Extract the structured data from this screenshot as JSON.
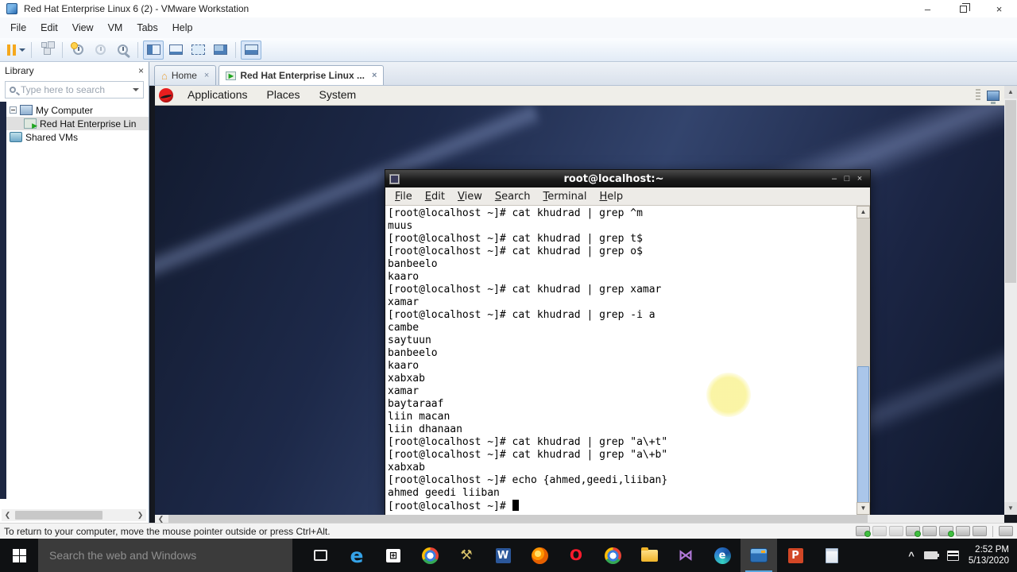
{
  "window": {
    "title": "Red Hat Enterprise Linux 6 (2) - VMware Workstation",
    "menus": [
      "File",
      "Edit",
      "View",
      "VM",
      "Tabs",
      "Help"
    ],
    "controls": {
      "minimize": "–",
      "close": "×"
    }
  },
  "toolbar": {
    "icons": [
      {
        "name": "pause",
        "caret": true
      },
      {
        "name": "ctrl-alt-del"
      },
      {
        "name": "take-snapshot"
      },
      {
        "name": "revert-snapshot",
        "disabled": true
      },
      {
        "name": "manage-snapshots"
      },
      {
        "name": "show-library",
        "pressed": true
      },
      {
        "name": "unity-view"
      },
      {
        "name": "full-screen"
      },
      {
        "name": "console-view"
      },
      {
        "name": "show-console",
        "pressed": true
      }
    ],
    "separators_after": [
      0,
      1,
      4,
      8
    ]
  },
  "tabs": [
    {
      "label": "Home",
      "icon": "home",
      "close": "×",
      "active": false
    },
    {
      "label": "Red Hat Enterprise Linux ...",
      "icon": "vm-play",
      "close": "×",
      "active": true
    }
  ],
  "library": {
    "title": "Library",
    "close": "×",
    "search_placeholder": "Type here to search",
    "tree": [
      {
        "label": "My Computer",
        "icon": "computer",
        "level": 0,
        "expander": true
      },
      {
        "label": "Red Hat Enterprise Lin",
        "icon": "vm",
        "level": 1,
        "selected": true
      },
      {
        "label": "Shared VMs",
        "icon": "shared-vms",
        "level": 0
      }
    ]
  },
  "guest": {
    "panel_menus": [
      "Applications",
      "Places",
      "System"
    ],
    "terminal": {
      "title": "root@localhost:~",
      "menus": [
        "File",
        "Edit",
        "View",
        "Search",
        "Terminal",
        "Help"
      ],
      "controls": [
        "–",
        "□",
        "×"
      ],
      "lines": [
        "[root@localhost ~]# cat khudrad | grep ^m",
        "muus",
        "[root@localhost ~]# cat khudrad | grep t$",
        "[root@localhost ~]# cat khudrad | grep o$",
        "banbeelo",
        "kaaro",
        "[root@localhost ~]# cat khudrad | grep xamar",
        "xamar",
        "[root@localhost ~]# cat khudrad | grep -i a",
        "cambe",
        "saytuun",
        "banbeelo",
        "kaaro",
        "xabxab",
        "xamar",
        "baytaraaf",
        "liin macan",
        "liin dhanaan",
        "[root@localhost ~]# cat khudrad | grep \"a\\+t\"",
        "[root@localhost ~]# cat khudrad | grep \"a\\+b\"",
        "xabxab",
        "[root@localhost ~]# echo {ahmed,geedi,liiban}",
        "ahmed geedi liiban",
        "[root@localhost ~]# "
      ]
    }
  },
  "status_bar": {
    "message": "To return to your computer, move the mouse pointer outside or press Ctrl+Alt.",
    "device_icons": [
      {
        "name": "hard-disk",
        "on": true
      },
      {
        "name": "cd-rom",
        "dim": true
      },
      {
        "name": "floppy",
        "dim": true
      },
      {
        "name": "network",
        "on": true
      },
      {
        "name": "printer"
      },
      {
        "name": "sound",
        "on": true
      },
      {
        "name": "usb"
      },
      {
        "name": "display"
      },
      {
        "name": "fullscreen-exit",
        "sep_before": true
      }
    ]
  },
  "taskbar": {
    "search_placeholder": "Search the web and Windows",
    "apps": [
      {
        "name": "task-view"
      },
      {
        "name": "edge",
        "glyph": "e"
      },
      {
        "name": "store",
        "glyph": "⊞"
      },
      {
        "name": "chrome"
      },
      {
        "name": "admin-tools",
        "glyph": "⚒"
      },
      {
        "name": "word",
        "glyph": "W"
      },
      {
        "name": "firefox"
      },
      {
        "name": "opera",
        "glyph": "O"
      },
      {
        "name": "chrome-2"
      },
      {
        "name": "file-explorer"
      },
      {
        "name": "visual-studio",
        "glyph": "⋈"
      },
      {
        "name": "edge-new",
        "glyph": "e"
      },
      {
        "name": "vmware",
        "active": true
      },
      {
        "name": "powerpoint",
        "glyph": "P"
      },
      {
        "name": "notepad"
      }
    ],
    "tray": {
      "chevron": "^",
      "time": "2:52 PM",
      "date": "5/13/2020"
    }
  }
}
